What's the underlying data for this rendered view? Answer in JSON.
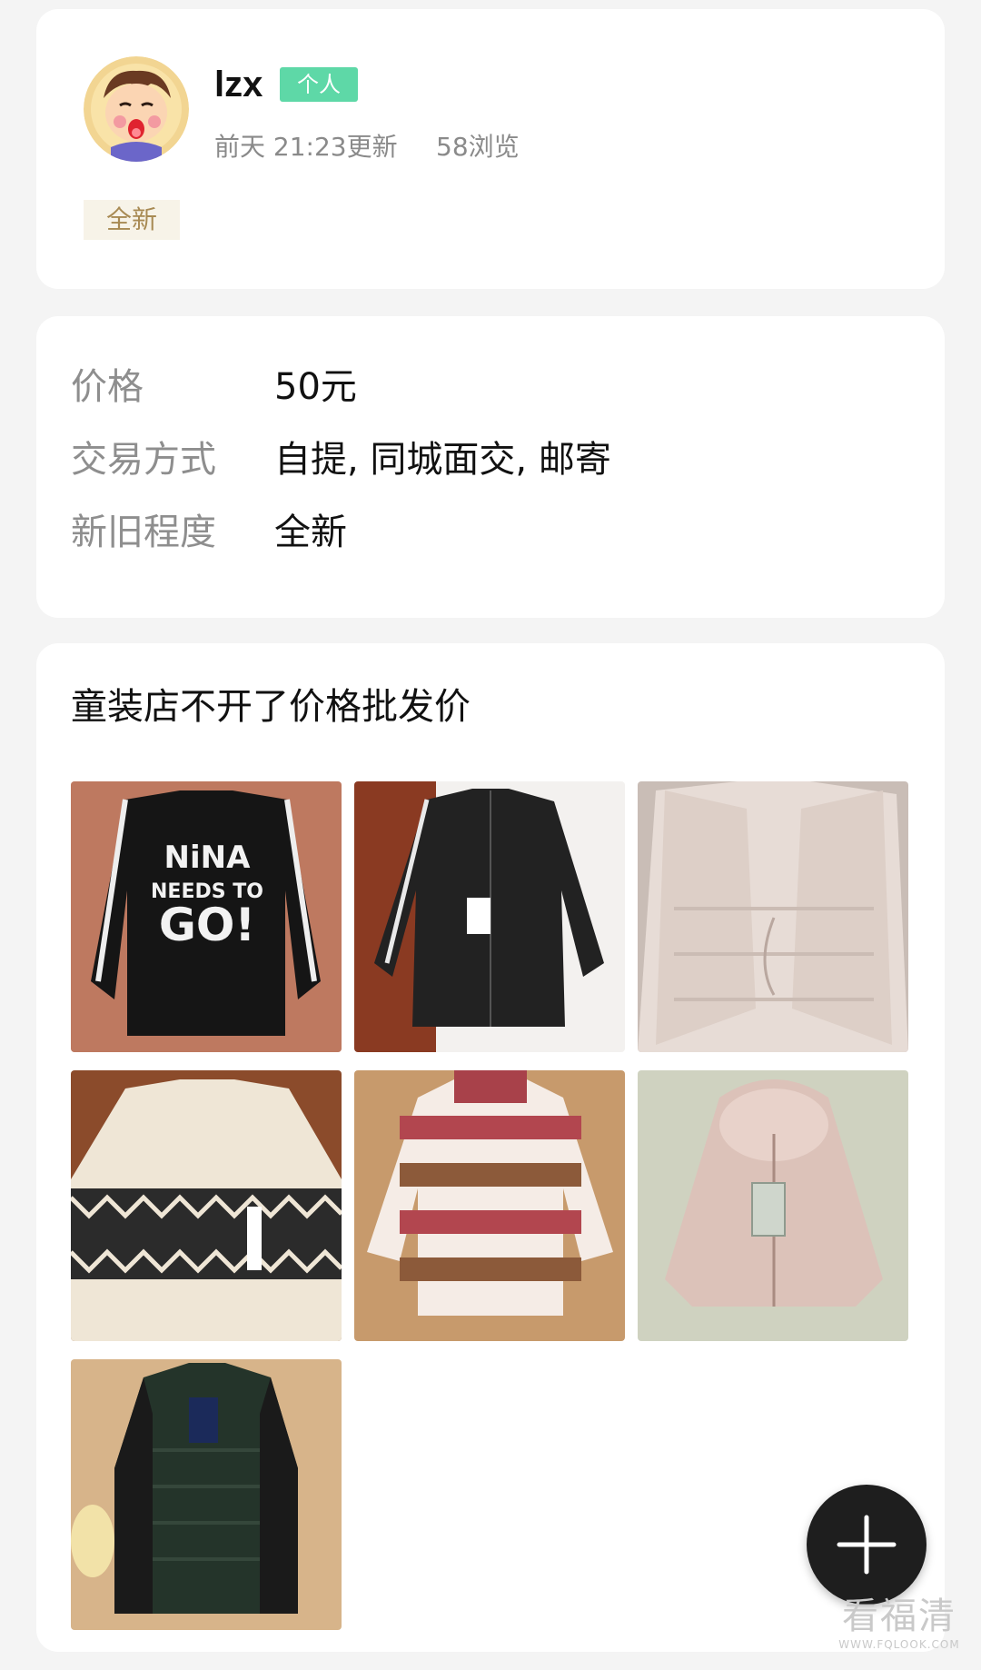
{
  "user": {
    "name": "lzx",
    "badge": "个人",
    "updated": "前天 21:23更新",
    "views": "58浏览",
    "condition_tag": "全新"
  },
  "details": {
    "rows": [
      {
        "label": "价格",
        "value": "50元"
      },
      {
        "label": "交易方式",
        "value": "自提, 同城面交, 邮寄"
      },
      {
        "label": "新旧程度",
        "value": "全新"
      }
    ]
  },
  "description": {
    "text": "童装店不开了价格批发价",
    "photos": [
      {
        "icon": "jacket-photo",
        "color": "#1b1b1b"
      },
      {
        "icon": "jacket-photo",
        "color": "#222222"
      },
      {
        "icon": "coat-photo",
        "color": "#e5d9d3"
      },
      {
        "icon": "sweater-photo",
        "color": "#efe6d6"
      },
      {
        "icon": "sweater-photo",
        "color": "#b4535a"
      },
      {
        "icon": "coat-photo",
        "color": "#dfc4bc"
      },
      {
        "icon": "jacket-photo",
        "color": "#24342a"
      }
    ]
  },
  "fab": {
    "icon": "plus-icon"
  },
  "watermark": {
    "main": "看福清",
    "sub": "WWW.FQLOOK.COM"
  }
}
